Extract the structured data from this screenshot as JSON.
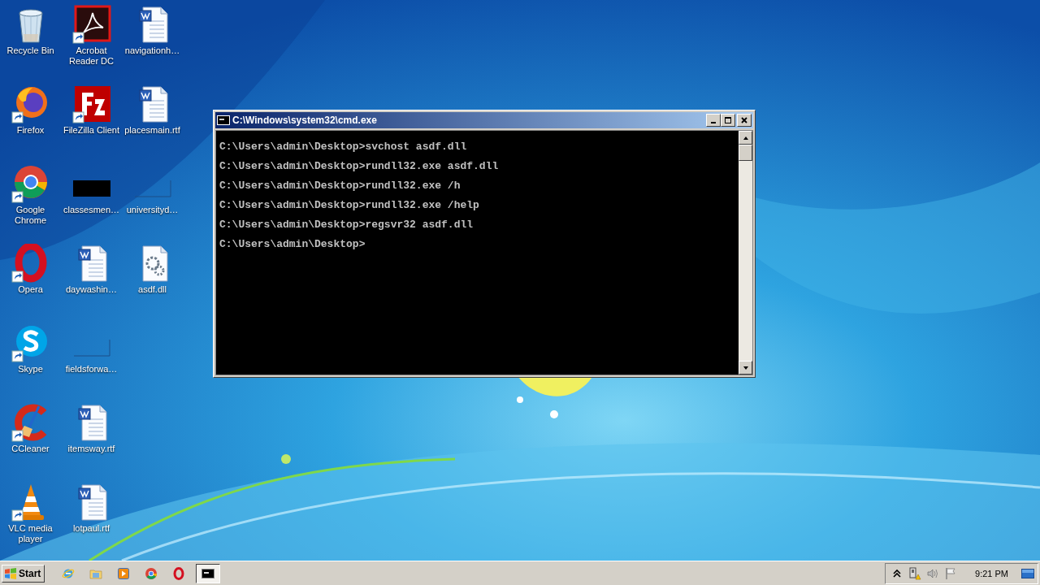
{
  "icons": [
    {
      "label": "Recycle Bin",
      "kind": "recycle",
      "shortcut": false
    },
    {
      "label": "Firefox",
      "kind": "firefox",
      "shortcut": true
    },
    {
      "label": "Google Chrome",
      "kind": "chrome",
      "shortcut": true
    },
    {
      "label": "Opera",
      "kind": "opera",
      "shortcut": true
    },
    {
      "label": "Skype",
      "kind": "skype",
      "shortcut": true
    },
    {
      "label": "CCleaner",
      "kind": "ccleaner",
      "shortcut": true
    },
    {
      "label": "VLC media player",
      "kind": "vlc",
      "shortcut": true
    },
    {
      "label": "Acrobat Reader DC",
      "kind": "acrobat",
      "shortcut": true
    },
    {
      "label": "FileZilla Client",
      "kind": "filezilla",
      "shortcut": true
    },
    {
      "label": "classesmen…",
      "kind": "darkthumb",
      "shortcut": false
    },
    {
      "label": "daywashin…",
      "kind": "word",
      "shortcut": false
    },
    {
      "label": "fieldsforwa…",
      "kind": "blankthumb",
      "shortcut": false
    },
    {
      "label": "itemsway.rtf",
      "kind": "word",
      "shortcut": false
    },
    {
      "label": "lotpaul.rtf",
      "kind": "word",
      "shortcut": false
    },
    {
      "label": "navigationh…",
      "kind": "word",
      "shortcut": false
    },
    {
      "label": "placesmain.rtf",
      "kind": "word",
      "shortcut": false
    },
    {
      "label": "universityd…",
      "kind": "blankthumb",
      "shortcut": false
    },
    {
      "label": "asdf.dll",
      "kind": "dll",
      "shortcut": false
    }
  ],
  "window": {
    "title": "C:\\Windows\\system32\\cmd.exe",
    "lines": [
      "C:\\Users\\admin\\Desktop>svchost asdf.dll",
      "C:\\Users\\admin\\Desktop>rundll32.exe asdf.dll",
      "C:\\Users\\admin\\Desktop>rundll32.exe /h",
      "C:\\Users\\admin\\Desktop>rundll32.exe /help",
      "C:\\Users\\admin\\Desktop>regsvr32 asdf.dll",
      "C:\\Users\\admin\\Desktop>"
    ]
  },
  "taskbar": {
    "start": "Start",
    "apps": [
      {
        "kind": "ie",
        "selected": false
      },
      {
        "kind": "folder",
        "selected": false
      },
      {
        "kind": "media",
        "selected": false
      },
      {
        "kind": "chrome",
        "selected": false
      },
      {
        "kind": "opera",
        "selected": false
      },
      {
        "kind": "cmd",
        "selected": true
      }
    ],
    "time": "9:21 PM"
  }
}
